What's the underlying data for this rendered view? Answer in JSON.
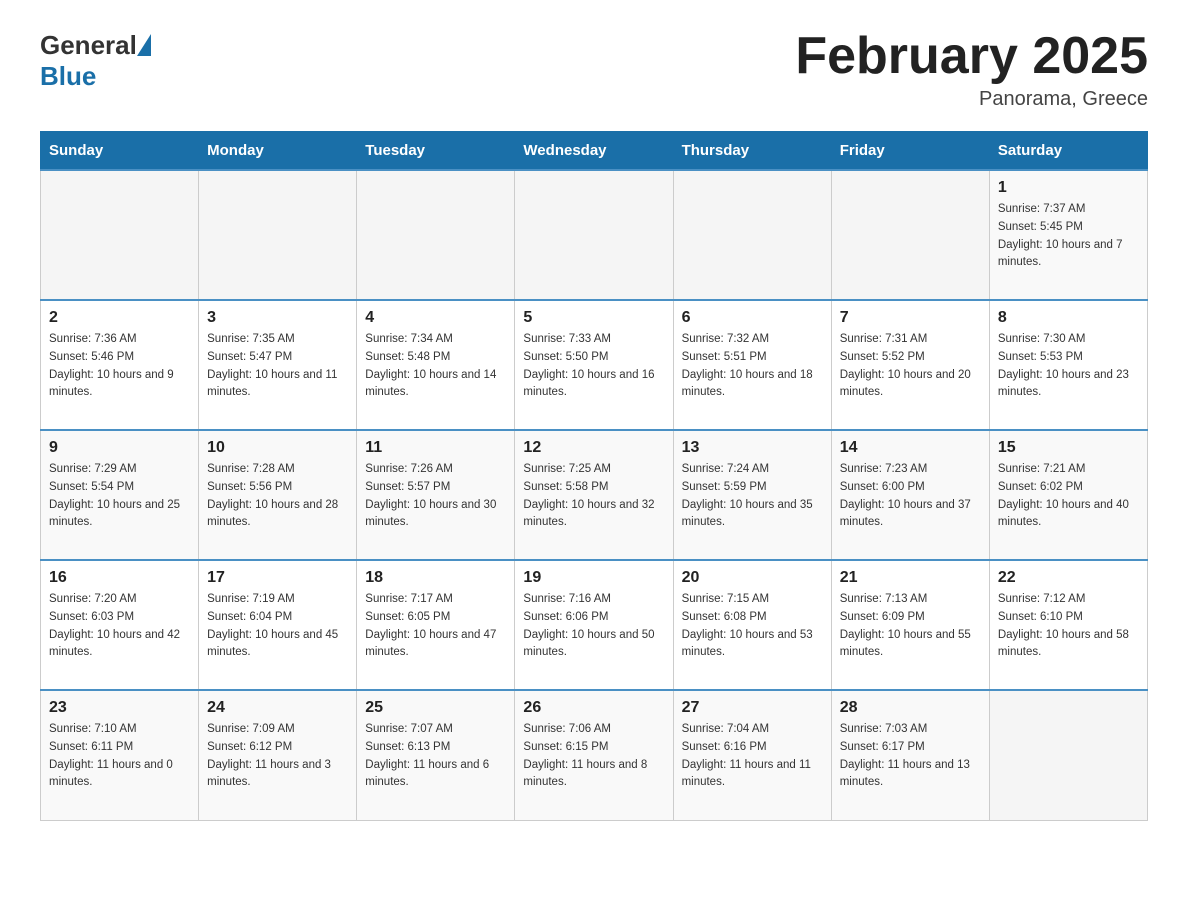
{
  "header": {
    "logo_text_general": "General",
    "logo_text_blue": "Blue",
    "month_title": "February 2025",
    "location": "Panorama, Greece"
  },
  "days_of_week": [
    "Sunday",
    "Monday",
    "Tuesday",
    "Wednesday",
    "Thursday",
    "Friday",
    "Saturday"
  ],
  "weeks": [
    [
      {
        "day": "",
        "info": ""
      },
      {
        "day": "",
        "info": ""
      },
      {
        "day": "",
        "info": ""
      },
      {
        "day": "",
        "info": ""
      },
      {
        "day": "",
        "info": ""
      },
      {
        "day": "",
        "info": ""
      },
      {
        "day": "1",
        "info": "Sunrise: 7:37 AM\nSunset: 5:45 PM\nDaylight: 10 hours and 7 minutes."
      }
    ],
    [
      {
        "day": "2",
        "info": "Sunrise: 7:36 AM\nSunset: 5:46 PM\nDaylight: 10 hours and 9 minutes."
      },
      {
        "day": "3",
        "info": "Sunrise: 7:35 AM\nSunset: 5:47 PM\nDaylight: 10 hours and 11 minutes."
      },
      {
        "day": "4",
        "info": "Sunrise: 7:34 AM\nSunset: 5:48 PM\nDaylight: 10 hours and 14 minutes."
      },
      {
        "day": "5",
        "info": "Sunrise: 7:33 AM\nSunset: 5:50 PM\nDaylight: 10 hours and 16 minutes."
      },
      {
        "day": "6",
        "info": "Sunrise: 7:32 AM\nSunset: 5:51 PM\nDaylight: 10 hours and 18 minutes."
      },
      {
        "day": "7",
        "info": "Sunrise: 7:31 AM\nSunset: 5:52 PM\nDaylight: 10 hours and 20 minutes."
      },
      {
        "day": "8",
        "info": "Sunrise: 7:30 AM\nSunset: 5:53 PM\nDaylight: 10 hours and 23 minutes."
      }
    ],
    [
      {
        "day": "9",
        "info": "Sunrise: 7:29 AM\nSunset: 5:54 PM\nDaylight: 10 hours and 25 minutes."
      },
      {
        "day": "10",
        "info": "Sunrise: 7:28 AM\nSunset: 5:56 PM\nDaylight: 10 hours and 28 minutes."
      },
      {
        "day": "11",
        "info": "Sunrise: 7:26 AM\nSunset: 5:57 PM\nDaylight: 10 hours and 30 minutes."
      },
      {
        "day": "12",
        "info": "Sunrise: 7:25 AM\nSunset: 5:58 PM\nDaylight: 10 hours and 32 minutes."
      },
      {
        "day": "13",
        "info": "Sunrise: 7:24 AM\nSunset: 5:59 PM\nDaylight: 10 hours and 35 minutes."
      },
      {
        "day": "14",
        "info": "Sunrise: 7:23 AM\nSunset: 6:00 PM\nDaylight: 10 hours and 37 minutes."
      },
      {
        "day": "15",
        "info": "Sunrise: 7:21 AM\nSunset: 6:02 PM\nDaylight: 10 hours and 40 minutes."
      }
    ],
    [
      {
        "day": "16",
        "info": "Sunrise: 7:20 AM\nSunset: 6:03 PM\nDaylight: 10 hours and 42 minutes."
      },
      {
        "day": "17",
        "info": "Sunrise: 7:19 AM\nSunset: 6:04 PM\nDaylight: 10 hours and 45 minutes."
      },
      {
        "day": "18",
        "info": "Sunrise: 7:17 AM\nSunset: 6:05 PM\nDaylight: 10 hours and 47 minutes."
      },
      {
        "day": "19",
        "info": "Sunrise: 7:16 AM\nSunset: 6:06 PM\nDaylight: 10 hours and 50 minutes."
      },
      {
        "day": "20",
        "info": "Sunrise: 7:15 AM\nSunset: 6:08 PM\nDaylight: 10 hours and 53 minutes."
      },
      {
        "day": "21",
        "info": "Sunrise: 7:13 AM\nSunset: 6:09 PM\nDaylight: 10 hours and 55 minutes."
      },
      {
        "day": "22",
        "info": "Sunrise: 7:12 AM\nSunset: 6:10 PM\nDaylight: 10 hours and 58 minutes."
      }
    ],
    [
      {
        "day": "23",
        "info": "Sunrise: 7:10 AM\nSunset: 6:11 PM\nDaylight: 11 hours and 0 minutes."
      },
      {
        "day": "24",
        "info": "Sunrise: 7:09 AM\nSunset: 6:12 PM\nDaylight: 11 hours and 3 minutes."
      },
      {
        "day": "25",
        "info": "Sunrise: 7:07 AM\nSunset: 6:13 PM\nDaylight: 11 hours and 6 minutes."
      },
      {
        "day": "26",
        "info": "Sunrise: 7:06 AM\nSunset: 6:15 PM\nDaylight: 11 hours and 8 minutes."
      },
      {
        "day": "27",
        "info": "Sunrise: 7:04 AM\nSunset: 6:16 PM\nDaylight: 11 hours and 11 minutes."
      },
      {
        "day": "28",
        "info": "Sunrise: 7:03 AM\nSunset: 6:17 PM\nDaylight: 11 hours and 13 minutes."
      },
      {
        "day": "",
        "info": ""
      }
    ]
  ]
}
